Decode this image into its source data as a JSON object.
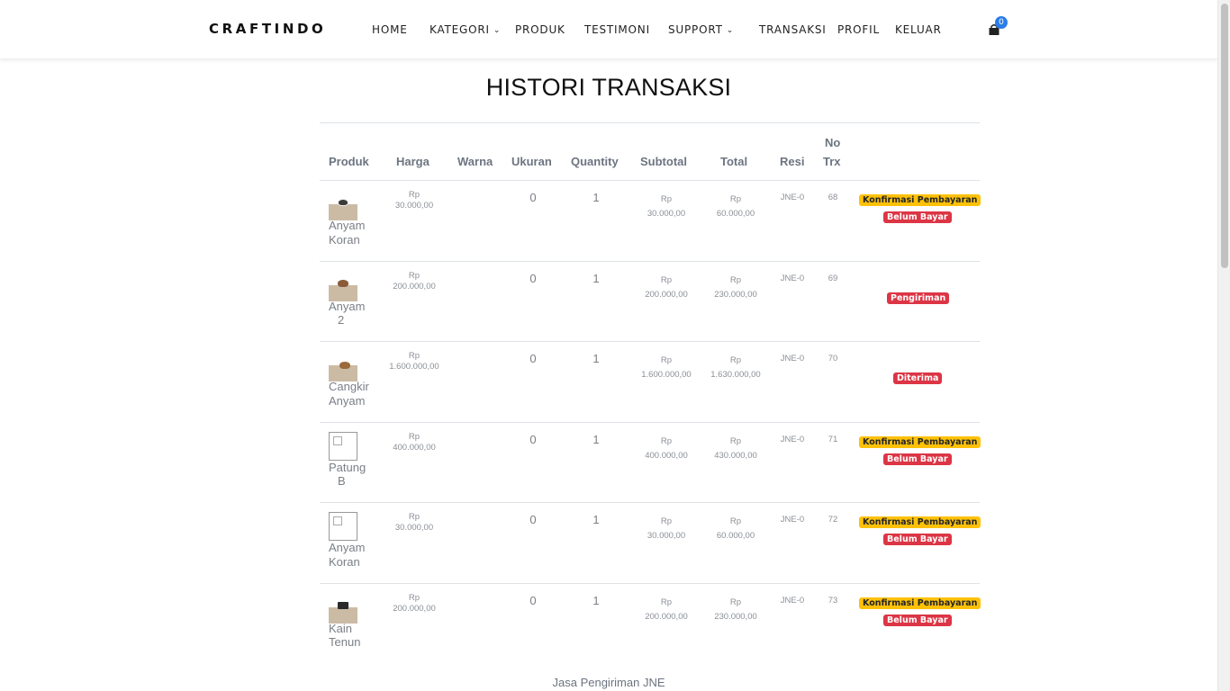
{
  "brand": "CRAFTINDO",
  "nav": {
    "home": "HOME",
    "kategori": "KATEGORI",
    "produk": "PRODUK",
    "testimoni": "TESTIMONI",
    "support": "SUPPORT",
    "transaksi": "TRANSAKSI",
    "profil": "PROFIL",
    "keluar": "KELUAR",
    "cart_count": "0"
  },
  "page_title": "HISTORI TRANSAKSI",
  "table": {
    "headers": {
      "produk": "Produk",
      "harga": "Harga",
      "warna": "Warna",
      "ukuran": "Ukuran",
      "quantity": "Quantity",
      "subtotal": "Subtotal",
      "total": "Total",
      "resi": "Resi",
      "no_trx_1": "No",
      "no_trx_2": "Trx"
    },
    "rows": [
      {
        "name_1": "Anyam",
        "name_2": "Koran",
        "harga_cur": "Rp",
        "harga": "30.000,00",
        "ukuran": "0",
        "qty": "1",
        "sub_cur": "Rp",
        "subtotal": "30.000,00",
        "tot_cur": "Rp",
        "total": "60.000,00",
        "resi": "JNE-0",
        "trx": "68",
        "status_1": "Konfirmasi Pembayaran",
        "status_2": "Belum Bayar"
      },
      {
        "name_1": "Anyam",
        "name_2": "2",
        "harga_cur": "Rp",
        "harga": "200.000,00",
        "ukuran": "0",
        "qty": "1",
        "sub_cur": "Rp",
        "subtotal": "200.000,00",
        "tot_cur": "Rp",
        "total": "230.000,00",
        "resi": "JNE-0",
        "trx": "69",
        "status_1": "Pengiriman"
      },
      {
        "name_1": "Cangkir",
        "name_2": "Anyam",
        "harga_cur": "Rp",
        "harga": "1.600.000,00",
        "ukuran": "0",
        "qty": "1",
        "sub_cur": "Rp",
        "subtotal": "1.600.000,00",
        "tot_cur": "Rp",
        "total": "1.630.000,00",
        "resi": "JNE-0",
        "trx": "70",
        "status_1": "Diterima"
      },
      {
        "name_1": "Patung",
        "name_2": "B",
        "harga_cur": "Rp",
        "harga": "400.000,00",
        "ukuran": "0",
        "qty": "1",
        "sub_cur": "Rp",
        "subtotal": "400.000,00",
        "tot_cur": "Rp",
        "total": "430.000,00",
        "resi": "JNE-0",
        "trx": "71",
        "status_1": "Konfirmasi Pembayaran",
        "status_2": "Belum Bayar"
      },
      {
        "name_1": "Anyam",
        "name_2": "Koran",
        "harga_cur": "Rp",
        "harga": "30.000,00",
        "ukuran": "0",
        "qty": "1",
        "sub_cur": "Rp",
        "subtotal": "30.000,00",
        "tot_cur": "Rp",
        "total": "60.000,00",
        "resi": "JNE-0",
        "trx": "72",
        "status_1": "Konfirmasi Pembayaran",
        "status_2": "Belum Bayar"
      },
      {
        "name_1": "Kain",
        "name_2": "Tenun",
        "harga_cur": "Rp",
        "harga": "200.000,00",
        "ukuran": "0",
        "qty": "1",
        "sub_cur": "Rp",
        "subtotal": "200.000,00",
        "tot_cur": "Rp",
        "total": "230.000,00",
        "resi": "JNE-0",
        "trx": "73",
        "status_1": "Konfirmasi Pembayaran",
        "status_2": "Belum Bayar"
      }
    ]
  },
  "footer_note": "Jasa Pengiriman JNE",
  "colors": {
    "warning": "#ffc107",
    "danger": "#dc3545",
    "badge_blue": "#2b7de9"
  }
}
